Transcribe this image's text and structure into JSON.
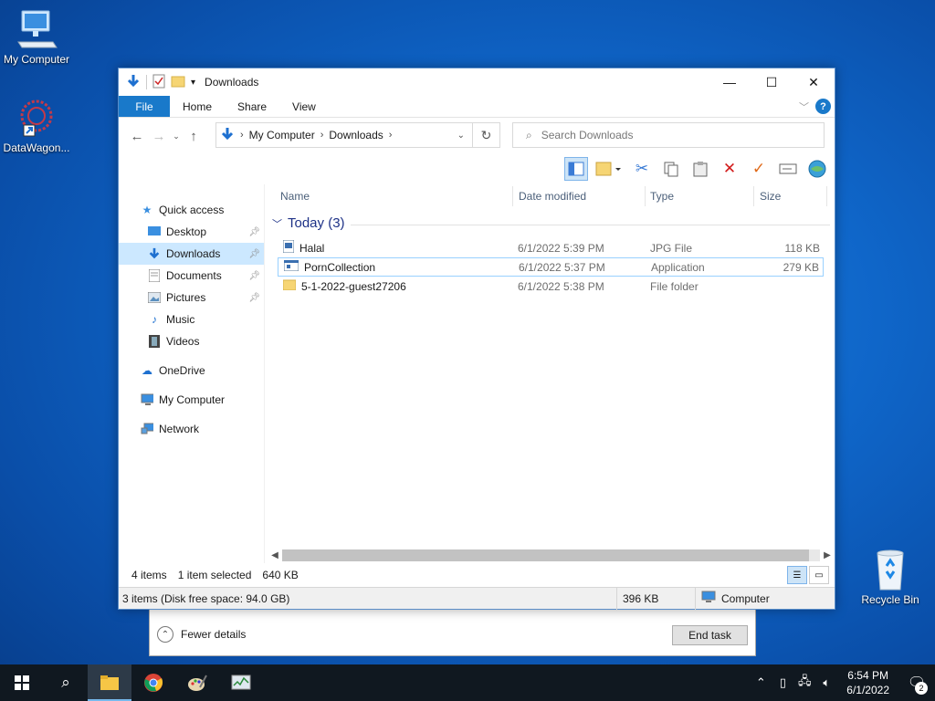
{
  "desktop": {
    "icons": [
      {
        "label": "My Computer"
      },
      {
        "label": "DataWagon..."
      },
      {
        "label": "Recycle Bin"
      }
    ]
  },
  "taskmgr": {
    "fewer_details": "Fewer details",
    "end_task": "End task"
  },
  "explorer": {
    "title": "Downloads",
    "ribbon_tabs": [
      "File",
      "Home",
      "Share",
      "View"
    ],
    "help": "?",
    "address": [
      "My Computer",
      "Downloads"
    ],
    "search_placeholder": "Search Downloads",
    "nav": {
      "quick_access": "Quick access",
      "items": [
        "Desktop",
        "Downloads",
        "Documents",
        "Pictures",
        "Music",
        "Videos"
      ],
      "onedrive": "OneDrive",
      "mycomputer": "My Computer",
      "network": "Network"
    },
    "columns": [
      "Name",
      "Date modified",
      "Type",
      "Size"
    ],
    "group": "Today (3)",
    "files": [
      {
        "name": "Halal",
        "date": "6/1/2022 5:39 PM",
        "type": "JPG File",
        "size": "118 KB"
      },
      {
        "name": "PornCollection",
        "date": "6/1/2022 5:37 PM",
        "type": "Application",
        "size": "279 KB"
      },
      {
        "name": "5-1-2022-guest27206",
        "date": "6/1/2022 5:38 PM",
        "type": "File folder",
        "size": ""
      }
    ],
    "status": {
      "items": "4 items",
      "selected": "1 item selected",
      "selsize": "640 KB"
    },
    "bottombar": {
      "summary": "3 items (Disk free space: 94.0 GB)",
      "size": "396 KB",
      "location": "Computer"
    }
  },
  "taskbar": {
    "time": "6:54 PM",
    "date": "6/1/2022",
    "notifications": "2"
  }
}
